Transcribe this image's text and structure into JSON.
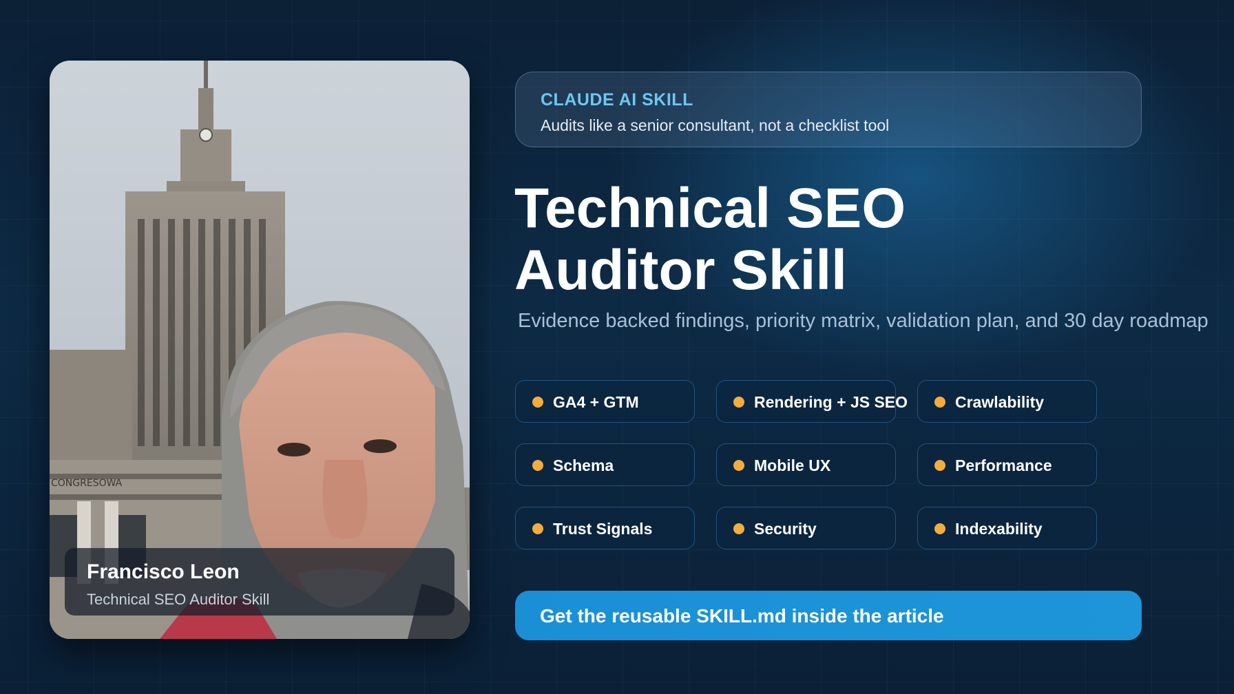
{
  "colors": {
    "background": "#0c2036",
    "accent_blue": "#1a8fd6",
    "badge_label": "#6cc7f4",
    "chip_dot": "#f3ac3e",
    "subtitle": "#a9c0d6"
  },
  "profile": {
    "name": "Francisco Leon",
    "role": "Technical SEO Auditor Skill"
  },
  "badge": {
    "label": "CLAUDE AI SKILL",
    "text": "Audits like a senior consultant, not a checklist tool"
  },
  "title": {
    "line1": "Technical SEO",
    "line2": "Auditor Skill"
  },
  "subtitle": "Evidence backed findings, priority matrix, validation plan, and 30 day roadmap",
  "chips": [
    {
      "label": "GA4 + GTM"
    },
    {
      "label": "Rendering + JS SEO"
    },
    {
      "label": "Crawlability"
    },
    {
      "label": "Schema"
    },
    {
      "label": "Mobile UX"
    },
    {
      "label": "Performance"
    },
    {
      "label": "Trust Signals"
    },
    {
      "label": "Security"
    },
    {
      "label": "Indexability"
    }
  ],
  "cta": {
    "label": "Get the reusable SKILL.md inside the article"
  }
}
